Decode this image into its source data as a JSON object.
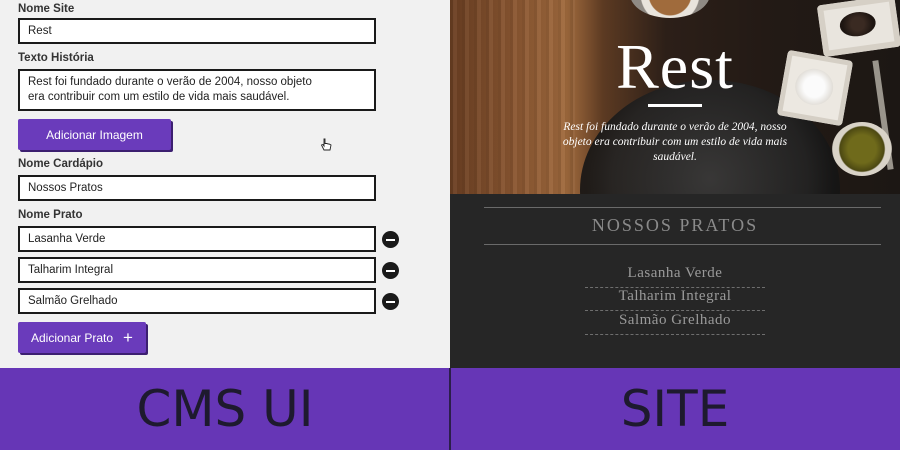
{
  "cms": {
    "site_name_label": "Nome Site",
    "site_name_value": "Rest",
    "story_label": "Texto História",
    "story_value": "Rest foi fundado durante o verão de 2004, nosso objeto\nera contribuir com um estilo de vida mais saudável.",
    "add_image_label": "Adicionar Imagem",
    "menu_name_label": "Nome Cardápio",
    "menu_name_value": "Nossos Pratos",
    "dish_name_label": "Nome Prato",
    "dishes": [
      "Lasanha Verde",
      "Talharim Integral",
      "Salmão Grelhado"
    ],
    "add_dish_label": "Adicionar Prato",
    "add_icon": "plus-icon",
    "remove_icon": "minus-circle-icon",
    "cursor_icon": "hand-cursor-icon"
  },
  "site": {
    "title": "Rest",
    "story": "Rest foi fundado durante o verão de 2004, nosso objeto era contribuir com um estilo de vida mais saudável.",
    "menu_title": "NOSSOS PRATOS",
    "dishes": [
      "Lasanha Verde",
      "Talharim Integral",
      "Salmão Grelhado"
    ]
  },
  "banners": {
    "left": "CMS UI",
    "right": "SITE"
  },
  "colors": {
    "accent_purple": "#6a3bbb",
    "banner_purple": "#6636b6",
    "site_background": "#262626",
    "cms_background": "#f1f1f1"
  }
}
